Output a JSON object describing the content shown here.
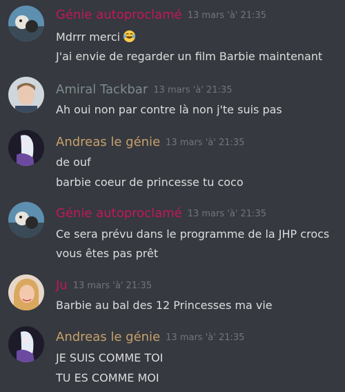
{
  "colors": {
    "background": "#36393f",
    "text": "#dcddde",
    "timestamp": "#72767d",
    "genie_autoproclame": "#c2185b",
    "amiral_tackbar": "#7f8c8d",
    "andreas_le_genie": "#c8a16c",
    "ju": "#c2185b"
  },
  "messages": [
    {
      "author": "Génie autoproclamé",
      "timestamp": "13 mars 'à' 21:35",
      "lines": [
        "Mdrrr merci",
        "J'ai envie de regarder un film Barbie maintenant"
      ],
      "emoji": "joy-emoji"
    },
    {
      "author": "Amiral Tackbar",
      "timestamp": "13 mars 'à' 21:35",
      "lines": [
        "Ah oui non par contre là non j'te suis pas"
      ]
    },
    {
      "author": "Andreas le génie",
      "timestamp": "13 mars 'à' 21:35",
      "lines": [
        "de ouf",
        "barbie coeur de princesse tu coco"
      ]
    },
    {
      "author": "Génie autoproclamé",
      "timestamp": "13 mars 'à' 21:35",
      "lines": [
        "Ce sera prévu dans le programme de la JHP crocs",
        "vous êtes pas prêt"
      ]
    },
    {
      "author": "Ju",
      "timestamp": "13 mars 'à' 21:35",
      "lines": [
        "Barbie au bal des 12 Princesses ma vie"
      ]
    },
    {
      "author": "Andreas le génie",
      "timestamp": "13 mars 'à' 21:35",
      "lines": [
        "JE SUIS COMME TOI",
        "TU ES COMME MOI"
      ]
    }
  ]
}
